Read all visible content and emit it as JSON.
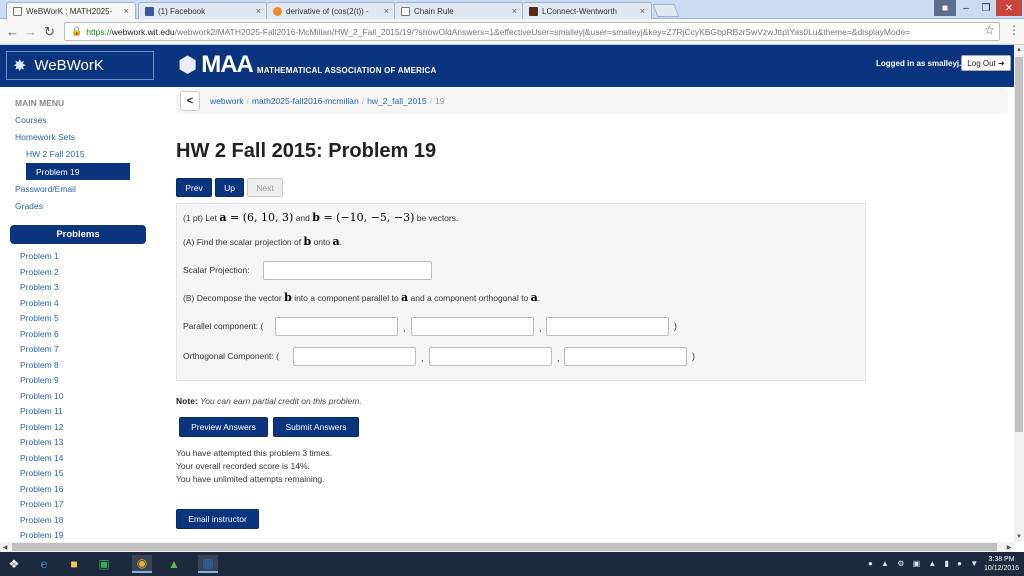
{
  "browser": {
    "tabs": [
      {
        "title": "WeBWorK : MATH2025-",
        "active": true
      },
      {
        "title": "(1) Facebook",
        "active": false
      },
      {
        "title": "derivative of (cos(2(t)) -",
        "active": false
      },
      {
        "title": "Chain Rule",
        "active": false
      },
      {
        "title": "LConnect-Wentworth",
        "active": false
      }
    ],
    "tab_close_glyph": "×",
    "url_proto": "https://",
    "url_host": "webwork.wit.edu",
    "url_path": "/webwork2/MATH2025-Fall2016-McMillan/HW_2_Fall_2015/19/?showOldAnswers=1&effectiveUser=smalleyj&user=smalleyj&key=Z7RjCcyKBGbpRBzrSwVzwJttptYas0Lu&theme=&displayMode="
  },
  "header": {
    "webwork_logo": "WeBWorK",
    "maa_logo": "MAA",
    "maa_subtitle": "MATHEMATICAL ASSOCIATION OF AMERICA",
    "logged_in": "Logged in as smalleyj.",
    "logout_label": "Log Out"
  },
  "sidebar": {
    "menu_heading": "MAIN MENU",
    "courses": "Courses",
    "homework_sets": "Homework Sets",
    "hw_set": "HW 2 Fall 2015",
    "selected_problem": "Problem 19",
    "password_email": "Password/Email",
    "grades": "Grades",
    "problems_heading": "Problems",
    "problems": [
      "Problem 1",
      "Problem 2",
      "Problem 3",
      "Problem 4",
      "Problem 5",
      "Problem 6",
      "Problem 7",
      "Problem 8",
      "Problem 9",
      "Problem 10",
      "Problem 11",
      "Problem 12",
      "Problem 13",
      "Problem 14",
      "Problem 15",
      "Problem 16",
      "Problem 17",
      "Problem 18",
      "Problem 19"
    ]
  },
  "breadcrumb": {
    "back": "<",
    "items": [
      "webwork",
      "math2025-fall2016-mcmillan",
      "hw_2_fall_2015"
    ],
    "current": "19",
    "separator": "/"
  },
  "main": {
    "title": "HW 2 Fall 2015: Problem 19",
    "prev_label": "Prev",
    "up_label": "Up",
    "next_label": "Next"
  },
  "problem": {
    "intro_prefix": "(1 pt) Let",
    "vec_a": "a",
    "a_value": " = (6, 10, 3)",
    "and_word": "and",
    "vec_b": "b",
    "b_value": " = (−10, −5, −3)",
    "intro_suffix": "be vectors.",
    "part_a_prefix": "(A) Find the scalar projection of",
    "onto_word": "onto",
    "part_a_period": ".",
    "scalar_label": "Scalar Projection:",
    "part_b_prefix": "(B) Decompose the vector",
    "part_b_mid": "into a component parallel to",
    "part_b_mid2": "and a component orthogonal to",
    "parallel_label": "Parallel component:",
    "orthogonal_label": "Orthogonal Component:",
    "open_paren": "(",
    "close_paren": ")",
    "comma": ","
  },
  "note": {
    "label": "Note:",
    "text": "You can earn partial credit on this problem."
  },
  "actions": {
    "preview_label": "Preview Answers",
    "submit_label": "Submit Answers",
    "email_label": "Email instructor"
  },
  "status": {
    "attempts": "You have attempted this problem 3 times.",
    "score": "Your overall recorded score is 14%.",
    "remaining": "You have unlimited attempts remaining."
  },
  "taskbar": {
    "clock_time": "3:38 PM",
    "clock_date": "10/12/2016"
  }
}
